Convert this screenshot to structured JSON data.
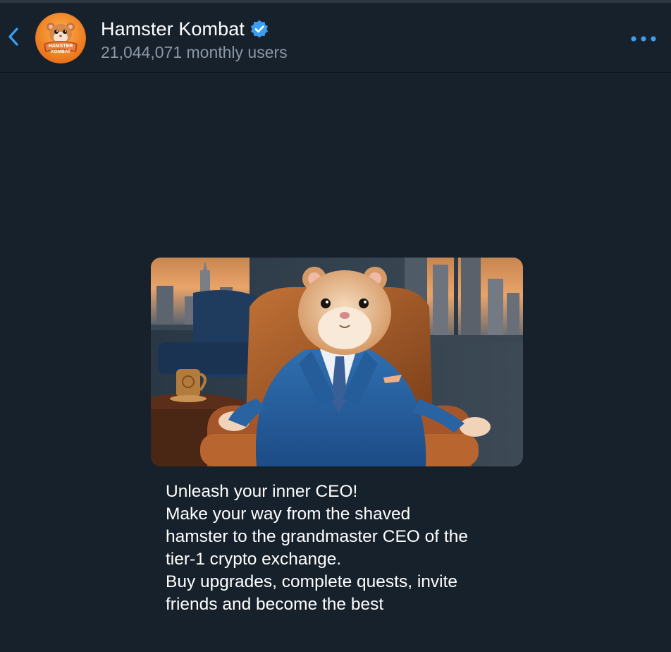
{
  "header": {
    "title": "Hamster Kombat",
    "subtitle": "21,044,071 monthly users",
    "avatar_text_line1": "HAMSTER",
    "avatar_text_line2": "KOMBAT",
    "back_icon": "chevron-left-icon",
    "verified_icon": "verified-badge-icon",
    "more_icon": "more-dots-icon"
  },
  "message": {
    "image_description_icon": "hamster-ceo-photo",
    "caption": "Unleash your inner CEO!\nMake your way from the shaved\nhamster to the grandmaster CEO of the\ntier-1 crypto exchange.\nBuy upgrades, complete quests, invite\nfriends and become the best"
  },
  "colors": {
    "background": "#17212b",
    "accent": "#3b9ef0",
    "subtitle": "#8a97a6",
    "text": "#ffffff"
  }
}
